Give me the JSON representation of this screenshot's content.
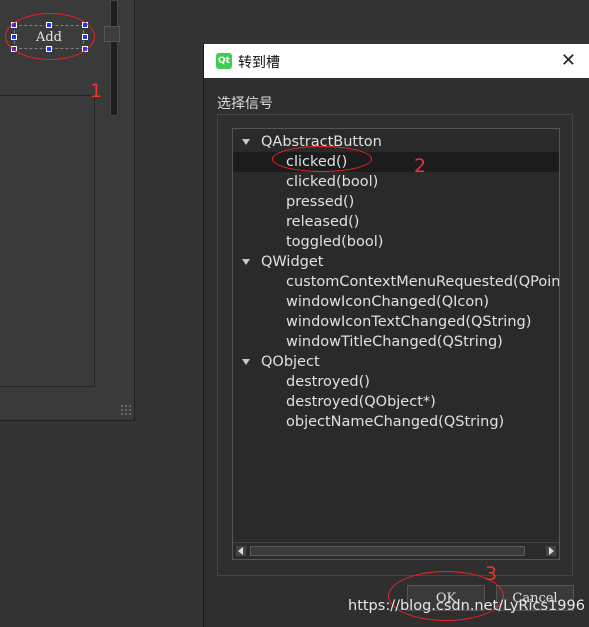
{
  "designer": {
    "add_button_label": "Add"
  },
  "annotations": {
    "n1": "1",
    "n2": "2",
    "n3": "3"
  },
  "dialog": {
    "title": "转到槽",
    "close_glyph": "✕",
    "app_icon_text": "Qt",
    "signal_label": "选择信号",
    "tree": [
      {
        "group": "QAbstractButton",
        "items": [
          "clicked()",
          "clicked(bool)",
          "pressed()",
          "released()",
          "toggled(bool)"
        ]
      },
      {
        "group": "QWidget",
        "items": [
          "customContextMenuRequested(QPoint",
          "windowIconChanged(QIcon)",
          "windowIconTextChanged(QString)",
          "windowTitleChanged(QString)"
        ]
      },
      {
        "group": "QObject",
        "items": [
          "destroyed()",
          "destroyed(QObject*)",
          "objectNameChanged(QString)"
        ]
      }
    ],
    "selected_item": "clicked()",
    "ok_label": "OK",
    "cancel_label": "Cancel"
  },
  "watermark": "https://blog.csdn.net/LyRics1996",
  "colors": {
    "annotation_red": "#e22222",
    "selection_handle": "#2233ff",
    "qt_green": "#41cd52"
  },
  "icons": [
    "qt-app-icon",
    "close-icon",
    "expand-arrow-icon",
    "scroll-left-icon",
    "scroll-right-icon",
    "resize-grip-icon"
  ]
}
